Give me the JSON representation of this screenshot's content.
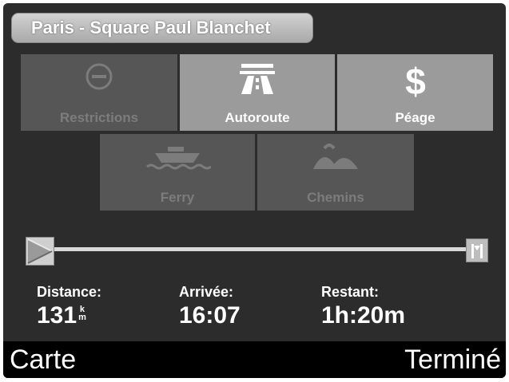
{
  "header": {
    "title": "Paris - Square Paul Blanchet"
  },
  "options": [
    {
      "label": "Restrictions",
      "icon": "no-entry-icon",
      "active": false
    },
    {
      "label": "Autoroute",
      "icon": "highway-icon",
      "active": true
    },
    {
      "label": "Péage",
      "icon": "dollar-icon",
      "active": true
    },
    {
      "label": "Ferry",
      "icon": "ferry-icon",
      "active": false
    },
    {
      "label": "Chemins",
      "icon": "hills-icon",
      "active": false
    }
  ],
  "stats": {
    "distance": {
      "label": "Distance:",
      "value": "131",
      "unit_top": "k",
      "unit_bottom": "m"
    },
    "arrival": {
      "label": "Arrivée:",
      "value": "16:07"
    },
    "remaining": {
      "label": "Restant:",
      "value": "1h:20m"
    }
  },
  "softkeys": {
    "left": "Carte",
    "right": "Terminé"
  },
  "colors": {
    "active_button": "#9b9b9b",
    "inactive_button": "#565656",
    "background": "#2c2c2c"
  }
}
